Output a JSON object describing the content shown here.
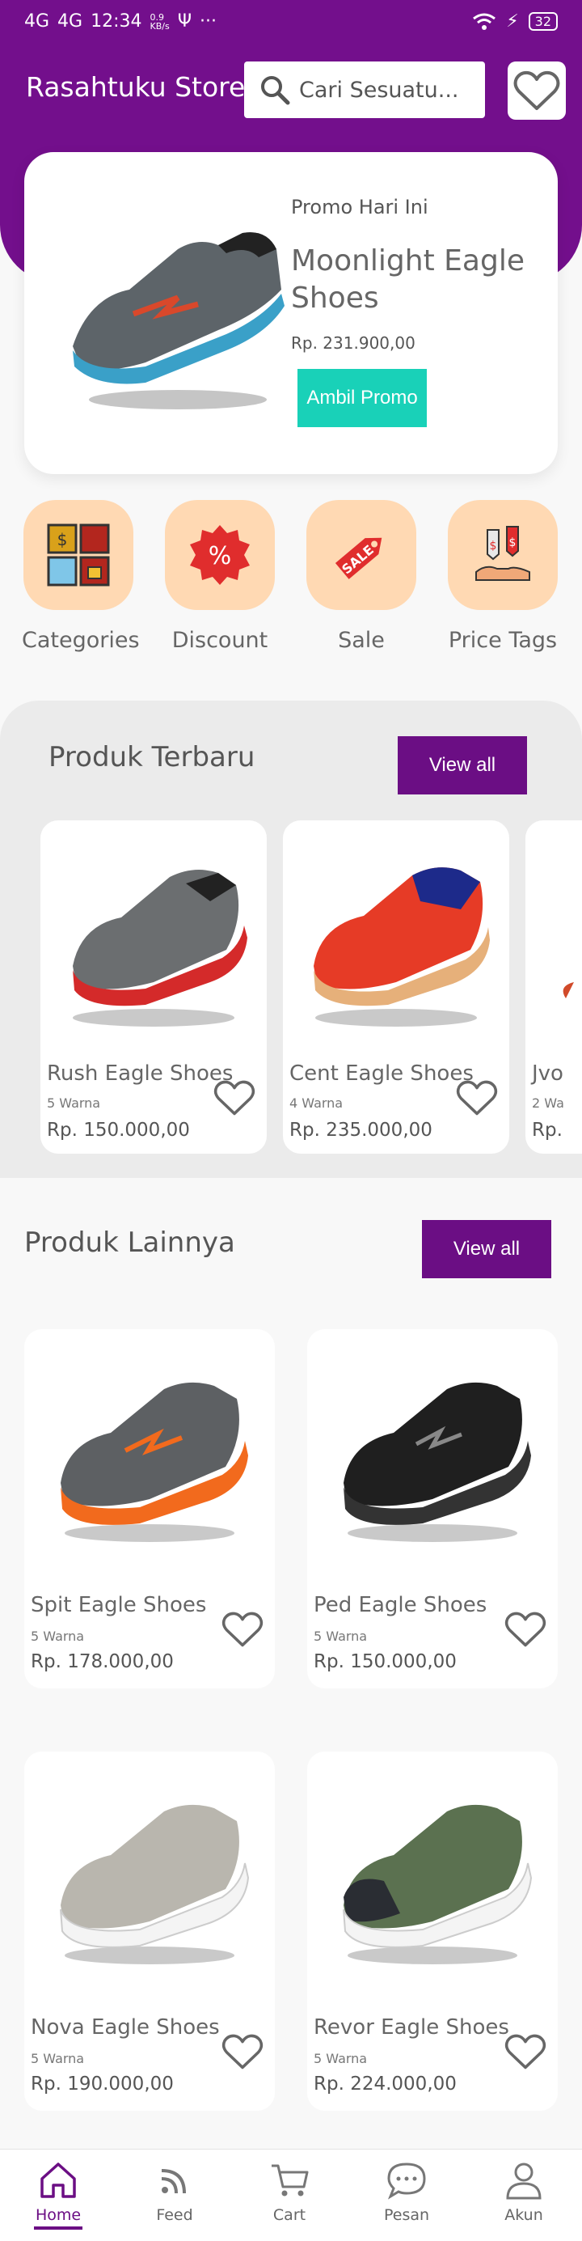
{
  "status_bar": {
    "signal1": "4G",
    "signal2": "4G",
    "time": "12:34",
    "net_speed": "0.9",
    "net_unit": "KB/s",
    "usb": "Ψ",
    "more": "···",
    "battery": "32"
  },
  "header": {
    "store_name": "Rasahtuku Store",
    "search_placeholder": "Cari Sesuatu..."
  },
  "promo": {
    "label": "Promo Hari Ini",
    "title": "Moonlight Eagle Shoes",
    "price": "Rp. 231.900,00",
    "button": "Ambil Promo"
  },
  "categories": [
    {
      "label": "Categories",
      "icon": "categories-icon"
    },
    {
      "label": "Discount",
      "icon": "discount-icon"
    },
    {
      "label": "Sale",
      "icon": "sale-tag-icon"
    },
    {
      "label": "Price Tags",
      "icon": "price-tags-icon"
    }
  ],
  "new_products": {
    "title": "Produk Terbaru",
    "view_all": "View all",
    "items": [
      {
        "name": "Rush Eagle Shoes",
        "colors": "5 Warna",
        "price": "Rp. 150.000,00",
        "color": "#6b6e70",
        "accent": "#d42a2a"
      },
      {
        "name": "Cent Eagle Shoes",
        "colors": "4 Warna",
        "price": "Rp. 235.000,00",
        "color": "#e63b26",
        "accent": "#1d2a8a"
      },
      {
        "name": "Jvo",
        "colors": "2 Wa",
        "price": "Rp.",
        "color": "#d14a2a",
        "accent": "#333333"
      }
    ]
  },
  "other_products": {
    "title": "Produk Lainnya",
    "view_all": "View all",
    "items": [
      {
        "name": "Spit Eagle Shoes",
        "colors": "5 Warna",
        "price": "Rp. 178.000,00",
        "color": "#5d6063",
        "accent": "#f26a1d"
      },
      {
        "name": "Ped Eagle Shoes",
        "colors": "5 Warna",
        "price": "Rp. 150.000,00",
        "color": "#1f1f1f",
        "accent": "#333333"
      },
      {
        "name": "Nova Eagle Shoes",
        "colors": "5 Warna",
        "price": "Rp. 190.000,00",
        "color": "#b9b6ae",
        "accent": "#ffffff"
      },
      {
        "name": "Revor Eagle Shoes",
        "colors": "5 Warna",
        "price": "Rp. 224.000,00",
        "color": "#5b7150",
        "accent": "#ffffff"
      }
    ]
  },
  "nav": {
    "items": [
      {
        "label": "Home",
        "icon": "home-icon",
        "active": true
      },
      {
        "label": "Feed",
        "icon": "feed-icon",
        "active": false
      },
      {
        "label": "Cart",
        "icon": "cart-icon",
        "active": false
      },
      {
        "label": "Pesan",
        "icon": "chat-icon",
        "active": false
      },
      {
        "label": "Akun",
        "icon": "user-icon",
        "active": false
      }
    ]
  },
  "colors": {
    "brand_purple": "#730f8c",
    "promo_button": "#19d1b8",
    "category_tile": "#ffd9b3"
  }
}
